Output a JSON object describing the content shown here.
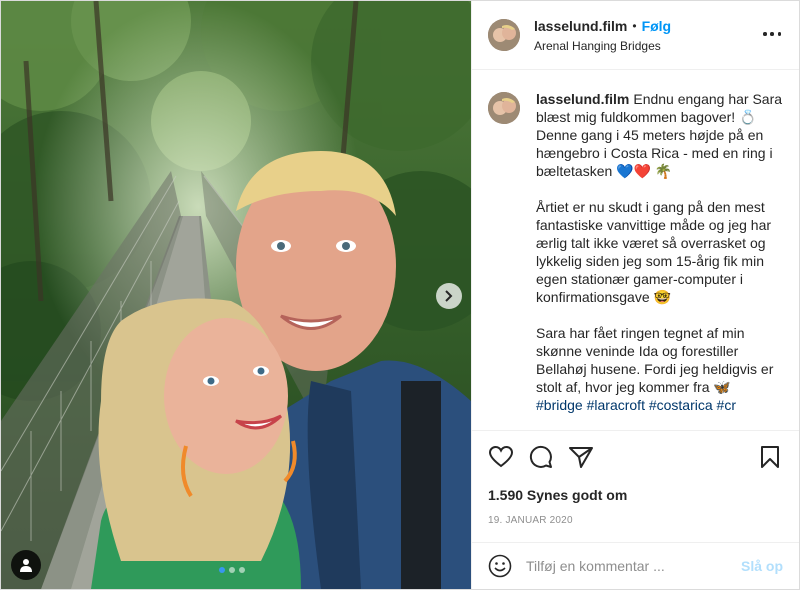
{
  "header": {
    "username": "lasselund.film",
    "separator": "•",
    "follow_label": "Følg",
    "location": "Arenal Hanging Bridges"
  },
  "caption": {
    "username": "lasselund.film",
    "paragraph1": "Endnu engang har Sara blæst mig fuldkommen bagover! 💍 Denne gang i 45 meters højde på en hængebro i Costa Rica - med en ring i bæltetasken 💙❤️ 🌴",
    "paragraph2": "Årtiet er nu skudt i gang på den mest fantastiske vanvittige måde og jeg har ærlig talt ikke været så overrasket og lykkelig siden jeg som 15-årig fik min egen stationær gamer-computer i konfirmationsgave 🤓",
    "paragraph3": "Sara har fået ringen tegnet af min skønne veninde Ida og forestiller Bellahøj husene. Fordi jeg heldigvis er stolt af, hvor jeg kommer fra 🦋",
    "hashtags": [
      "#bridge",
      "#laracroft",
      "#costarica",
      "#cr"
    ]
  },
  "actions": {
    "like_icon": "heart-icon",
    "comment_icon": "comment-icon",
    "share_icon": "paper-plane-icon",
    "save_icon": "bookmark-icon"
  },
  "likes_text": "1.590 Synes godt om",
  "date": "19. JANUAR 2020",
  "comment": {
    "placeholder": "Tilføj en kommentar ...",
    "post_label": "Slå op"
  },
  "carousel": {
    "slide_count": 3,
    "active_index": 0
  },
  "colors": {
    "accent": "#0095f6",
    "post_disabled": "#b2dffc",
    "hashtag": "#00376b",
    "carousel_active": "#3897f0"
  }
}
